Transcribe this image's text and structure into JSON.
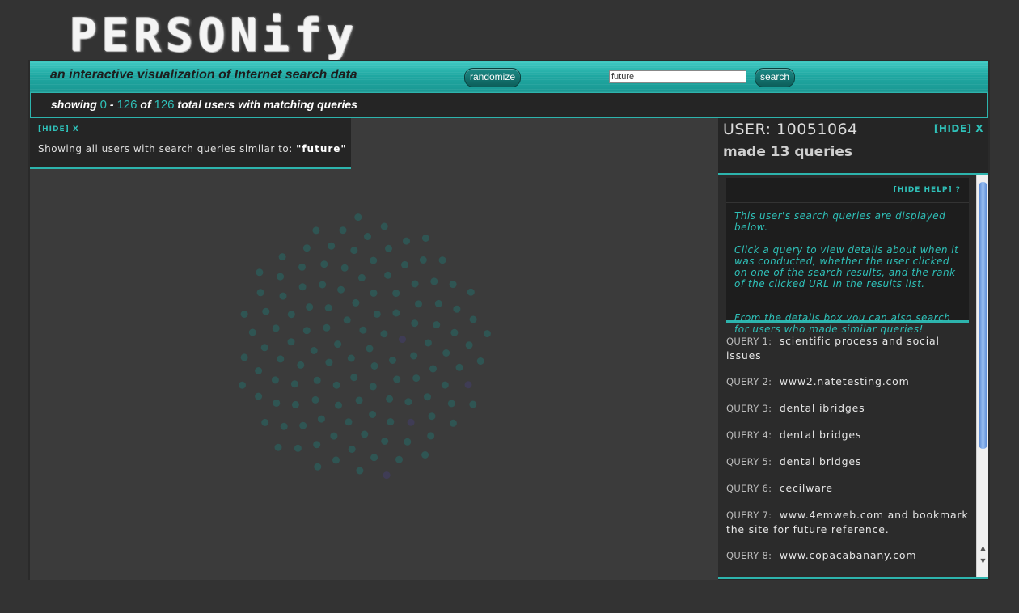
{
  "logo": {
    "text": "PERSONify"
  },
  "banner": {
    "tagline": "an interactive visualization of Internet search data",
    "randomize_label": "randomize",
    "search_value": "future",
    "search_label": "search"
  },
  "status": {
    "showing": "showing",
    "from": "0",
    "dash": "-",
    "to": "126",
    "of": "of",
    "total": "126",
    "suffix": "total users with matching queries"
  },
  "query_box": {
    "hide_label": "[HIDE] X",
    "description": "Showing all users with search queries similar to:",
    "term": "\"future\""
  },
  "user_panel": {
    "user_label": "USER: 10051064",
    "hide_label": "[HIDE] X",
    "made": "made 13 queries",
    "hide_help": "[HIDE HELP] ?",
    "help_1": "This user's search queries are displayed below.",
    "help_2": "Click a query to view details about when it was conducted, whether the user clicked on one of the search results, and the rank of the clicked URL in the results list.",
    "help_3": "From the details box you can also search for users who made similar queries!",
    "queries": [
      {
        "label": "QUERY 1:",
        "text": "scientific process and social issues"
      },
      {
        "label": "QUERY 2:",
        "text": "www2.natetesting.com"
      },
      {
        "label": "QUERY 3:",
        "text": "dental ibridges"
      },
      {
        "label": "QUERY 4:",
        "text": "dental bridges"
      },
      {
        "label": "QUERY 5:",
        "text": "dental bridges"
      },
      {
        "label": "QUERY 6:",
        "text": "cecilware"
      },
      {
        "label": "QUERY 7:",
        "text": "www.4emweb.com and bookmark the site for future reference."
      },
      {
        "label": "QUERY 8:",
        "text": "www.copacabanany.com"
      }
    ]
  },
  "colors": {
    "accent": "#2db4ad",
    "dot": "#2f5553",
    "dot_highlight": "#3f3c55"
  }
}
